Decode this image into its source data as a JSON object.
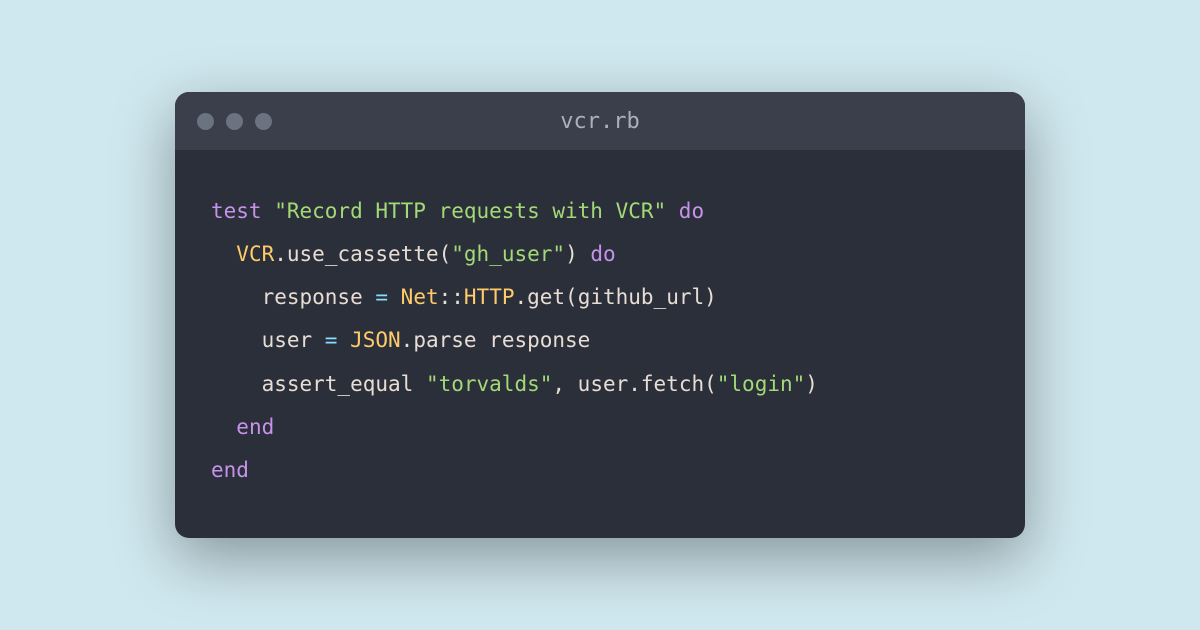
{
  "window": {
    "title": "vcr.rb"
  },
  "code": {
    "line1": {
      "test": "test ",
      "str": "\"Record HTTP requests with VCR\"",
      "do": " do"
    },
    "line2": {
      "indent": "  ",
      "vcr": "VCR",
      "dot": ".",
      "method": "use_cassette(",
      "str": "\"gh_user\"",
      "close": ") ",
      "do": "do"
    },
    "line3": {
      "indent": "    ",
      "var": "response ",
      "eq": "= ",
      "net": "Net",
      "colons": "::",
      "http": "HTTP",
      "rest": ".get(github_url)"
    },
    "line4": {
      "indent": "    ",
      "var": "user ",
      "eq": "= ",
      "json": "JSON",
      "rest": ".parse response"
    },
    "line5": {
      "indent": "    ",
      "method": "assert_equal ",
      "str1": "\"torvalds\"",
      "comma": ", user.fetch(",
      "str2": "\"login\"",
      "close": ")"
    },
    "line6": {
      "indent": "  ",
      "end": "end"
    },
    "line7": {
      "end": "end"
    }
  }
}
